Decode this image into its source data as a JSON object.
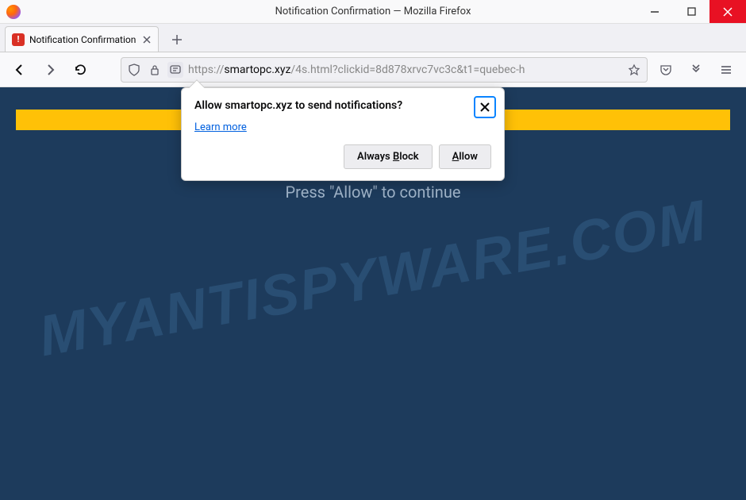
{
  "window": {
    "title": "Notification Confirmation — Mozilla Firefox"
  },
  "tab": {
    "title": "Notification Confirmation"
  },
  "url": {
    "protocol": "https://",
    "host": "smartopc.xyz",
    "path": "/4s.html?clickid=8d878xrvc7vc3c&t1=quebec-h"
  },
  "page": {
    "prompt": "Press \"Allow\" to continue",
    "watermark": "MYANTISPYWARE.COM"
  },
  "popup": {
    "title": "Allow smartopc.xyz to send notifications?",
    "learn_more": "Learn more",
    "always_block_label_pre": "Always ",
    "always_block_label_u": "B",
    "always_block_label_post": "lock",
    "allow_label_u": "A",
    "allow_label_post": "llow"
  }
}
